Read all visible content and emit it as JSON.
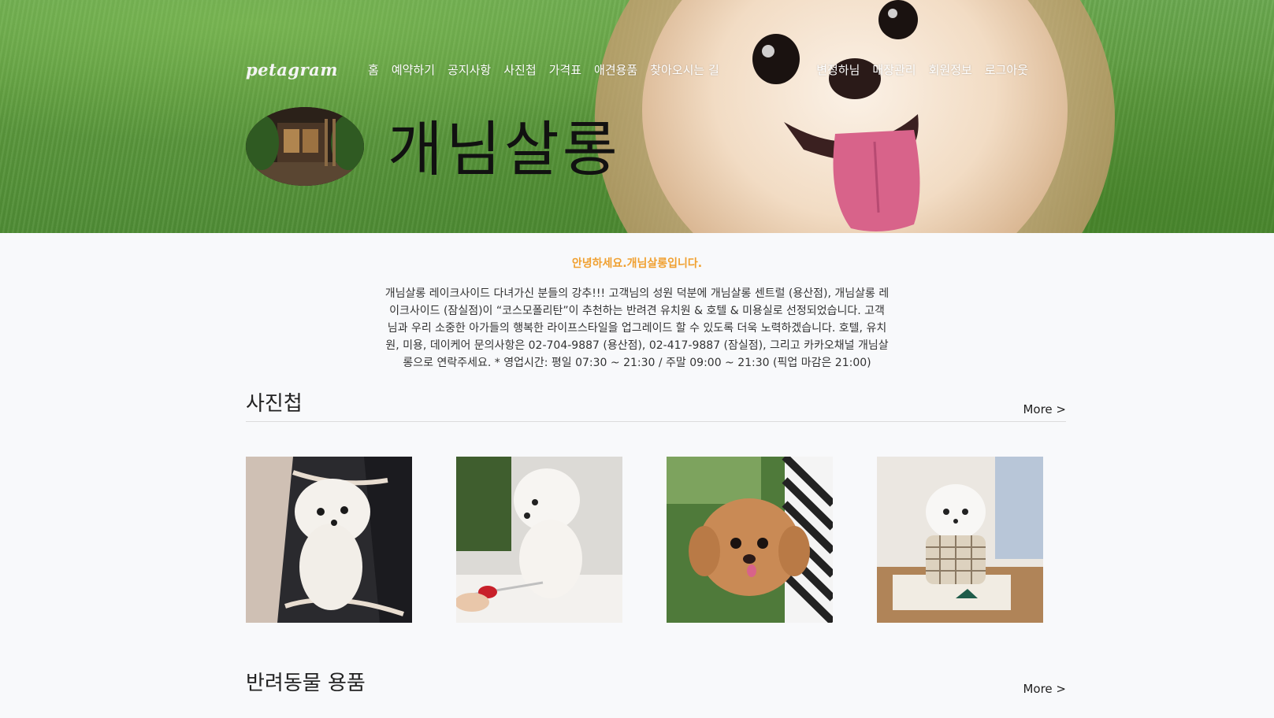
{
  "brand": "petagram",
  "nav": {
    "left": [
      "홈",
      "예약하기",
      "공지사항",
      "사진첩",
      "가격표",
      "애견용품",
      "찾아오시는 길"
    ],
    "right": [
      "변정하님",
      "매장관리",
      "회원정보",
      "로그아웃"
    ]
  },
  "hero": {
    "title": "개님살롱"
  },
  "intro": {
    "heading": "안녕하세요.개님살롱입니다.",
    "body": "개님살롱 레이크사이드 다녀가신 분들의 강추!!! 고객님의 성원 덕분에 개님살롱 센트럴 (용산점), 개님살롱 레이크사이드 (잠실점)이 “코스모폴리탄”이 추천하는 반려견 유치원 & 호텔 & 미용실로 선정되었습니다. 고객님과 우리 소중한 아가들의 행복한 라이프스타일을 업그레이드 할 수 있도록 더욱 노력하겠습니다. 호텔, 유치원, 미용, 데이케어 문의사항은 02-704-9887 (용산점), 02-417-9887 (잠실점), 그리고 카카오채널 개님살롱으로 연락주세요. * 영업시간: 평일 07:30 ~ 21:30 / 주말 09:00 ~ 21:30 (픽업 마감은 21:00)"
  },
  "gallery": {
    "title": "사진첩",
    "more": "More >"
  },
  "products": {
    "title": "반려동물 용품",
    "more": "More >"
  },
  "colors": {
    "accent": "#f0a030",
    "grass": "#5d9a3e"
  }
}
